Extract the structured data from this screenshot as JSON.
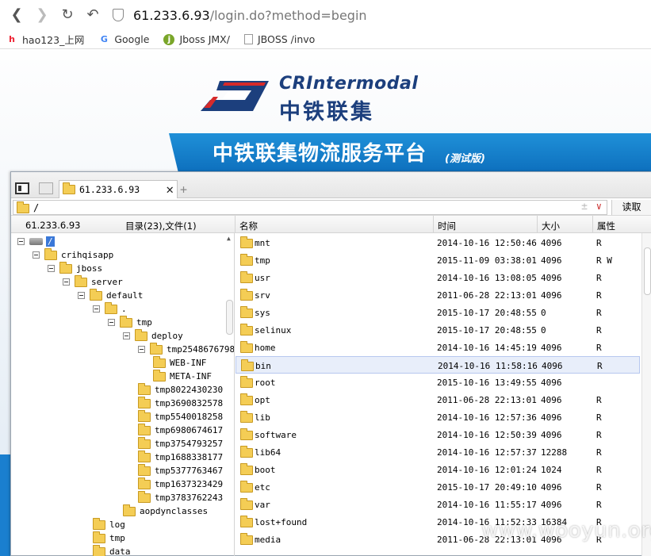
{
  "browser": {
    "url_host": "61.233.6.93",
    "url_path": "/login.do?method=begin",
    "bookmarks": [
      {
        "label": "hao123_上网",
        "icon": "hao123-icon"
      },
      {
        "label": "Google",
        "icon": "google-icon"
      },
      {
        "label": "Jboss JMX/",
        "icon": "jboss-icon"
      },
      {
        "label": "JBOSS /invo",
        "icon": "page-icon"
      }
    ]
  },
  "site": {
    "logo_en": "CRIntermodal",
    "logo_cn": "中铁联集",
    "banner_title": "中铁联集物流服务平台",
    "banner_sub": "(测试版)",
    "accent_color": "#1a86d2",
    "brand_color": "#1c3f7d"
  },
  "filemanager": {
    "tab_label": "61.233.6.93",
    "path": "/",
    "read_button": "读取",
    "server_ip": "61.233.6.93",
    "summary": "目录(23),文件(1)",
    "columns": {
      "name": "名称",
      "time": "时间",
      "size": "大小",
      "attr": "属性"
    },
    "tree": [
      {
        "label": "/",
        "depth": 0,
        "type": "drive",
        "expanded": true
      },
      {
        "label": "crihqisapp",
        "depth": 1,
        "type": "folder",
        "expanded": true
      },
      {
        "label": "jboss",
        "depth": 2,
        "type": "folder",
        "expanded": true
      },
      {
        "label": "server",
        "depth": 3,
        "type": "folder",
        "expanded": true
      },
      {
        "label": "default",
        "depth": 4,
        "type": "folder",
        "expanded": true
      },
      {
        "label": ".",
        "depth": 5,
        "type": "folder",
        "expanded": true
      },
      {
        "label": "tmp",
        "depth": 6,
        "type": "folder",
        "expanded": true
      },
      {
        "label": "deploy",
        "depth": 7,
        "type": "folder",
        "expanded": true
      },
      {
        "label": "tmp2548676798",
        "depth": 8,
        "type": "folder",
        "expanded": true
      },
      {
        "label": "WEB-INF",
        "depth": 9,
        "type": "folder",
        "expanded": false
      },
      {
        "label": "META-INF",
        "depth": 9,
        "type": "folder",
        "expanded": false
      },
      {
        "label": "tmp8022430230",
        "depth": 8,
        "type": "folder",
        "expanded": false
      },
      {
        "label": "tmp3690832578",
        "depth": 8,
        "type": "folder",
        "expanded": false
      },
      {
        "label": "tmp5540018258",
        "depth": 8,
        "type": "folder",
        "expanded": false
      },
      {
        "label": "tmp6980674617",
        "depth": 8,
        "type": "folder",
        "expanded": false
      },
      {
        "label": "tmp3754793257",
        "depth": 8,
        "type": "folder",
        "expanded": false
      },
      {
        "label": "tmp1688338177",
        "depth": 8,
        "type": "folder",
        "expanded": false
      },
      {
        "label": "tmp5377763467",
        "depth": 8,
        "type": "folder",
        "expanded": false
      },
      {
        "label": "tmp1637323429",
        "depth": 8,
        "type": "folder",
        "expanded": false
      },
      {
        "label": "tmp3783762243",
        "depth": 8,
        "type": "folder",
        "expanded": false
      },
      {
        "label": "aopdynclasses",
        "depth": 7,
        "type": "folder",
        "expanded": false
      },
      {
        "label": "log",
        "depth": 5,
        "type": "folder",
        "expanded": false
      },
      {
        "label": "tmp",
        "depth": 5,
        "type": "folder",
        "expanded": false
      },
      {
        "label": "data",
        "depth": 5,
        "type": "folder",
        "expanded": false
      }
    ],
    "files": [
      {
        "name": "mnt",
        "time": "2014-10-16 12:50:46",
        "size": "4096",
        "attr": "R"
      },
      {
        "name": "tmp",
        "time": "2015-11-09 03:38:01",
        "size": "4096",
        "attr": "R W"
      },
      {
        "name": "usr",
        "time": "2014-10-16 13:08:05",
        "size": "4096",
        "attr": "R"
      },
      {
        "name": "srv",
        "time": "2011-06-28 22:13:01",
        "size": "4096",
        "attr": "R"
      },
      {
        "name": "sys",
        "time": "2015-10-17 20:48:55",
        "size": "0",
        "attr": "R"
      },
      {
        "name": "selinux",
        "time": "2015-10-17 20:48:55",
        "size": "0",
        "attr": "R"
      },
      {
        "name": "home",
        "time": "2014-10-16 14:45:19",
        "size": "4096",
        "attr": "R"
      },
      {
        "name": "bin",
        "time": "2014-10-16 11:58:16",
        "size": "4096",
        "attr": "R"
      },
      {
        "name": "root",
        "time": "2015-10-16 13:49:55",
        "size": "4096",
        "attr": ""
      },
      {
        "name": "opt",
        "time": "2011-06-28 22:13:01",
        "size": "4096",
        "attr": "R"
      },
      {
        "name": "lib",
        "time": "2014-10-16 12:57:36",
        "size": "4096",
        "attr": "R"
      },
      {
        "name": "software",
        "time": "2014-10-16 12:50:39",
        "size": "4096",
        "attr": "R"
      },
      {
        "name": "lib64",
        "time": "2014-10-16 12:57:37",
        "size": "12288",
        "attr": "R"
      },
      {
        "name": "boot",
        "time": "2014-10-16 12:01:24",
        "size": "1024",
        "attr": "R"
      },
      {
        "name": "etc",
        "time": "2015-10-17 20:49:10",
        "size": "4096",
        "attr": "R"
      },
      {
        "name": "var",
        "time": "2014-10-16 11:55:17",
        "size": "4096",
        "attr": "R"
      },
      {
        "name": "lost+found",
        "time": "2014-10-16 11:52:33",
        "size": "16384",
        "attr": "R"
      },
      {
        "name": "media",
        "time": "2011-06-28 22:13:01",
        "size": "4096",
        "attr": "R"
      }
    ],
    "selected_file": "bin"
  },
  "watermark": "www.wooyun.org"
}
